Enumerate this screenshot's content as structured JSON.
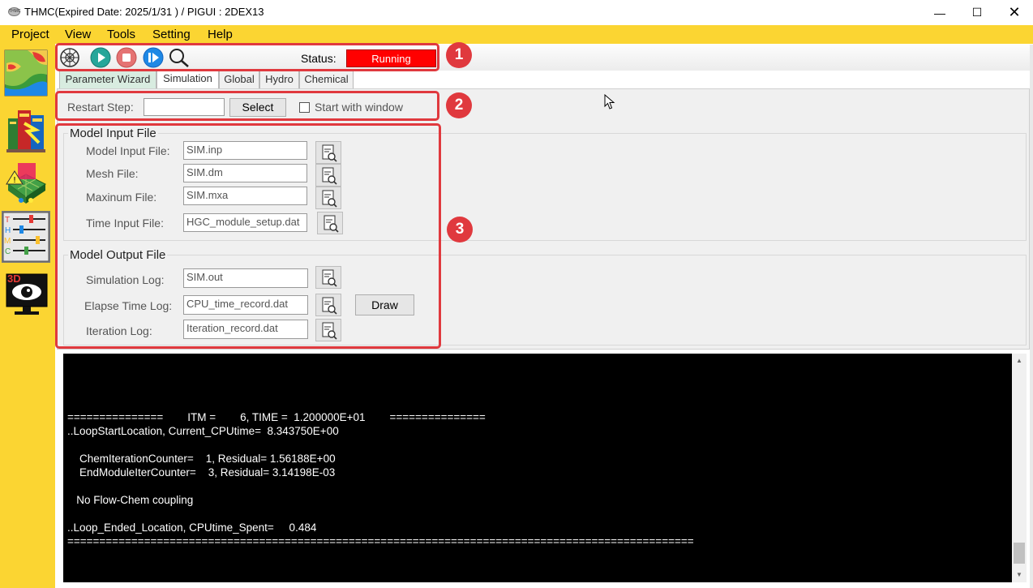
{
  "window": {
    "title": "THMC(Expired Date: 2025/1/31 ) / PIGUI : 2DEX13",
    "app_icon_text": "THMC",
    "minimize": "—",
    "maximize": "☐",
    "close": "✕"
  },
  "menu": [
    "Project",
    "View",
    "Tools",
    "Setting",
    "Help"
  ],
  "dock": {
    "items": [
      "map-tool",
      "books-tool",
      "mesh-tool",
      "thmc-tool",
      "3d-viewer-tool"
    ],
    "thmc_letters": [
      "T",
      "H",
      "M",
      "C"
    ],
    "viewer_label": "3D"
  },
  "toolbar": {
    "icons": [
      "wheel-icon",
      "play-icon",
      "stop-icon",
      "step-icon",
      "search-icon"
    ],
    "status_label": "Status:",
    "status_value": "Running"
  },
  "tabs": [
    "Parameter Wizard",
    "Simulation",
    "Global",
    "Hydro",
    "Chemical"
  ],
  "restart": {
    "label": "Restart Step:",
    "value": "",
    "select_button": "Select",
    "start_with_window": "Start with window"
  },
  "input_group": {
    "title": "Model Input File",
    "rows": [
      {
        "label": "Model Input File:",
        "value": "SIM.inp"
      },
      {
        "label": "Mesh File:",
        "value": "SIM.dm"
      },
      {
        "label": "Maxinum File:",
        "value": "SIM.mxa"
      },
      {
        "label": "Time Input File:",
        "value": "HGC_module_setup.dat"
      }
    ]
  },
  "output_group": {
    "title": "Model Output File",
    "rows": [
      {
        "label": "Simulation Log:",
        "value": "SIM.out"
      },
      {
        "label": "Elapse Time Log:",
        "value": "CPU_time_record.dat"
      },
      {
        "label": "Iteration Log:",
        "value": "Iteration_record.dat"
      }
    ],
    "draw_button": "Draw"
  },
  "badges": [
    "1",
    "2",
    "3"
  ],
  "console": {
    "lines": [
      "===============        ITM =        6, TIME =  1.200000E+01        ===============",
      "..LoopStartLocation, Current_CPUtime=  8.343750E+00",
      "    ChemIterationCounter=    1, Residual= 1.56188E+00",
      "    EndModuleIterCounter=    3, Residual= 3.14198E-03",
      "   No Flow-Chem coupling",
      "..Loop_Ended_Location, CPUtime_Spent=     0.484",
      "=================================================================================================="
    ]
  },
  "scroll": {
    "up": "▲",
    "down": "▼"
  }
}
